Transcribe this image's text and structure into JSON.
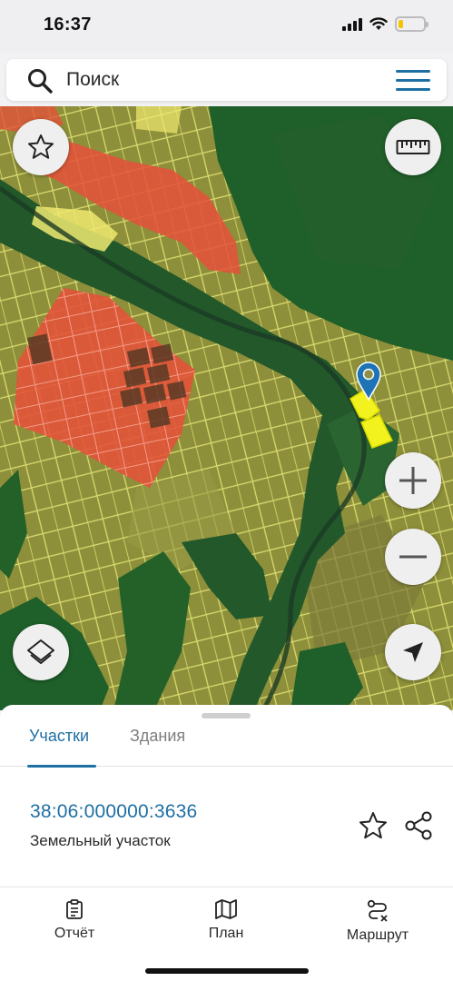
{
  "status": {
    "time": "16:37",
    "battery_level": 0.2
  },
  "search": {
    "placeholder": "Поиск"
  },
  "map": {
    "colors": {
      "forest": "#1f5f2a",
      "field": "#8d8f3a",
      "boundary": "#e8e87a",
      "red_zone": "#e2533a",
      "selected": "#f2f21e",
      "pin": "#1d73b6"
    }
  },
  "sheet": {
    "tabs": [
      {
        "label": "Участки",
        "active": true
      },
      {
        "label": "Здания",
        "active": false
      }
    ],
    "result": {
      "cadastral_number": "38:06:000000:3636",
      "type": "Земельный участок"
    }
  },
  "nav": {
    "items": [
      {
        "label": "Отчёт",
        "icon": "report-icon"
      },
      {
        "label": "План",
        "icon": "map-icon"
      },
      {
        "label": "Маршрут",
        "icon": "route-icon"
      }
    ]
  }
}
